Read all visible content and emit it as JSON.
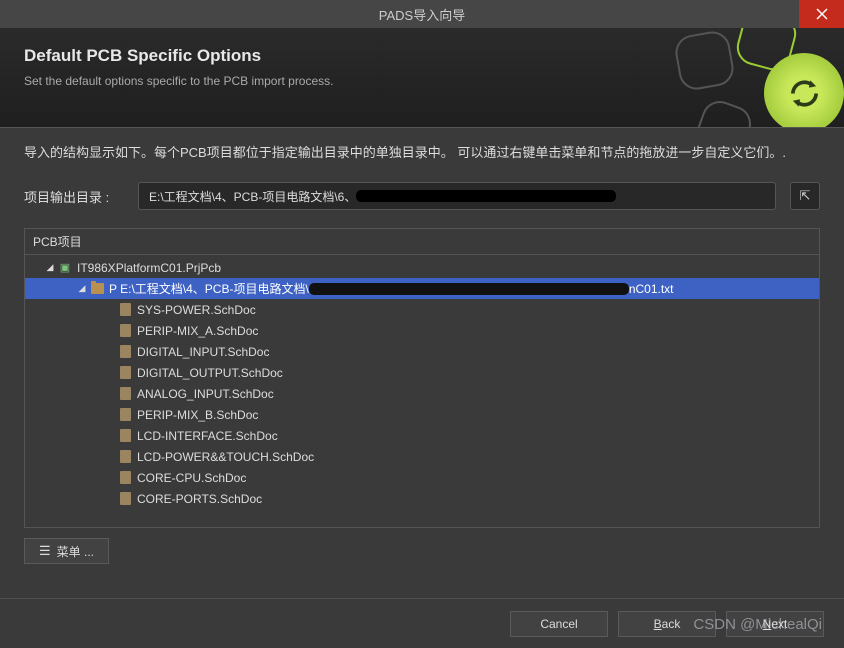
{
  "titlebar": {
    "title": "PADS导入向导"
  },
  "header": {
    "title": "Default PCB Specific Options",
    "subtitle": "Set the default options specific to the PCB import process."
  },
  "intro": "导入的结构显示如下。每个PCB项目都位于指定输出目录中的单独目录中。 可以通过右键单击菜单和节点的拖放进一步自定义它们。.",
  "output": {
    "label": "项目输出目录 :",
    "path_prefix": "E:\\工程文档\\4、PCB-项目电路文档\\6、",
    "browse_glyph": "⇱"
  },
  "tree": {
    "header": "PCB项目",
    "project": "IT986XPlatformC01.PrjPcb",
    "selected_prefix": "P E:\\工程文档\\4、PCB-项目电路文档\\",
    "selected_suffix": "nC01.txt",
    "items": [
      "SYS-POWER.SchDoc",
      "PERIP-MIX_A.SchDoc",
      "DIGITAL_INPUT.SchDoc",
      "DIGITAL_OUTPUT.SchDoc",
      "ANALOG_INPUT.SchDoc",
      "PERIP-MIX_B.SchDoc",
      "LCD-INTERFACE.SchDoc",
      "LCD-POWER&&TOUCH.SchDoc",
      "CORE-CPU.SchDoc",
      "CORE-PORTS.SchDoc"
    ]
  },
  "menu": {
    "label": "菜单 ..."
  },
  "footer": {
    "cancel": "Cancel",
    "back_u": "B",
    "back_rest": "ack",
    "next_u": "N",
    "next_rest": "ext"
  },
  "watermark": "CSDN @MichealQi"
}
